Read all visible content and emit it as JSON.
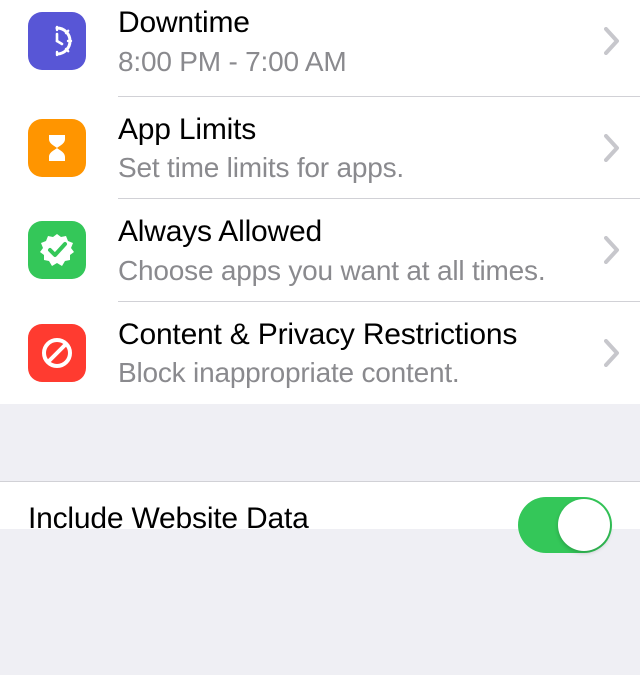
{
  "section1": {
    "items": [
      {
        "title": "Downtime",
        "subtitle": "8:00 PM - 7:00 AM"
      },
      {
        "title": "App Limits",
        "subtitle": "Set time limits for apps."
      },
      {
        "title": "Always Allowed",
        "subtitle": "Choose apps you want at all times."
      },
      {
        "title": "Content & Privacy Restrictions",
        "subtitle": "Block inappropriate content."
      }
    ]
  },
  "section2": {
    "include_website_data": {
      "label": "Include Website Data",
      "value": true
    }
  }
}
